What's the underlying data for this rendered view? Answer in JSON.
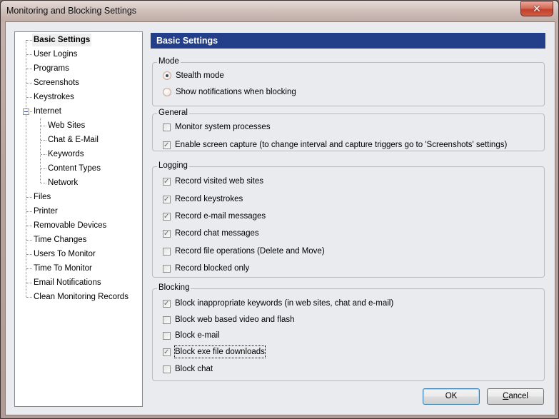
{
  "window": {
    "title": "Monitoring and Blocking Settings",
    "close_icon": "close-icon"
  },
  "tree": {
    "items": [
      {
        "label": "Basic Settings",
        "selected": true,
        "level": 0
      },
      {
        "label": "User Logins",
        "level": 0
      },
      {
        "label": "Programs",
        "level": 0
      },
      {
        "label": "Screenshots",
        "level": 0
      },
      {
        "label": "Keystrokes",
        "level": 0
      },
      {
        "label": "Internet",
        "level": 0,
        "expanded": true
      },
      {
        "label": "Web Sites",
        "level": 1
      },
      {
        "label": "Chat & E-Mail",
        "level": 1
      },
      {
        "label": "Keywords",
        "level": 1
      },
      {
        "label": "Content Types",
        "level": 1
      },
      {
        "label": "Network",
        "level": 1
      },
      {
        "label": "Files",
        "level": 0
      },
      {
        "label": "Printer",
        "level": 0
      },
      {
        "label": "Removable Devices",
        "level": 0
      },
      {
        "label": "Time Changes",
        "level": 0
      },
      {
        "label": "Users To Monitor",
        "level": 0
      },
      {
        "label": "Time To Monitor",
        "level": 0
      },
      {
        "label": "Email Notifications",
        "level": 0
      },
      {
        "label": "Clean Monitoring Records",
        "level": 0
      }
    ]
  },
  "panel": {
    "header": "Basic Settings",
    "colors": {
      "header_bg": "#243f89",
      "header_fg": "#ffffff"
    },
    "groups": [
      {
        "label": "Mode",
        "type": "radio",
        "options": [
          {
            "label": "Stealth mode",
            "checked": true
          },
          {
            "label": "Show notifications when blocking",
            "checked": false
          }
        ]
      },
      {
        "label": "General",
        "type": "checkbox",
        "options": [
          {
            "label": "Monitor system processes",
            "checked": false
          },
          {
            "label": "Enable screen capture (to change  interval and capture triggers go to 'Screenshots' settings)",
            "checked": true
          }
        ]
      },
      {
        "label": "Logging",
        "type": "checkbox",
        "options": [
          {
            "label": "Record visited web sites",
            "checked": true
          },
          {
            "label": "Record keystrokes",
            "checked": true
          },
          {
            "label": "Record e-mail messages",
            "checked": true
          },
          {
            "label": "Record chat messages",
            "checked": true
          },
          {
            "label": "Record file operations (Delete and Move)",
            "checked": false
          },
          {
            "label": "Record blocked only",
            "checked": false
          }
        ]
      },
      {
        "label": "Blocking",
        "type": "checkbox",
        "options": [
          {
            "label": "Block inappropriate keywords (in web sites, chat and e-mail)",
            "checked": true
          },
          {
            "label": "Block web based video and flash",
            "checked": false
          },
          {
            "label": "Block e-mail",
            "checked": false
          },
          {
            "label": "Block exe file downloads",
            "checked": true,
            "focused": true
          },
          {
            "label": "Block chat",
            "checked": false
          }
        ]
      }
    ]
  },
  "buttons": {
    "ok": "OK",
    "cancel": "Cancel"
  }
}
